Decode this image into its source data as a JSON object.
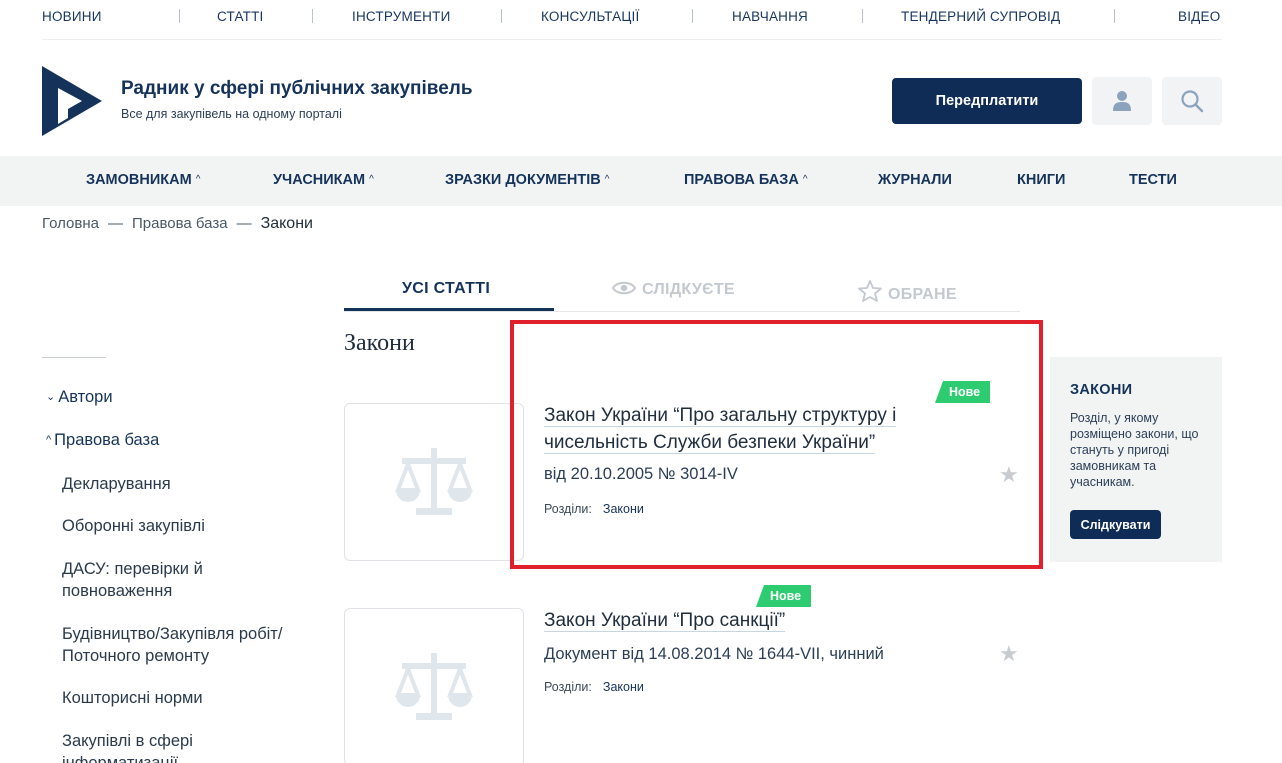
{
  "topnav": [
    "НОВИНИ",
    "СТАТТІ",
    "ІНСТРУМЕНТИ",
    "КОНСУЛЬТАЦІЇ",
    "НАВЧАННЯ",
    "ТЕНДЕРНИЙ СУПРОВІД",
    "ВІДЕО"
  ],
  "header": {
    "title": "Радник у сфері публічних закупівель",
    "subtitle": "Все для закупівель на одному порталі",
    "subscribe_label": "Передплатити",
    "icons": [
      "user-icon",
      "search-icon"
    ]
  },
  "mainnav": [
    {
      "label": "ЗАМОВНИКАМ",
      "dropdown": true
    },
    {
      "label": "УЧАСНИКАМ",
      "dropdown": true
    },
    {
      "label": "ЗРАЗКИ ДОКУМЕНТІВ",
      "dropdown": true
    },
    {
      "label": "ПРАВОВА БАЗА",
      "dropdown": true
    },
    {
      "label": "ЖУРНАЛИ",
      "dropdown": false
    },
    {
      "label": "КНИГИ",
      "dropdown": false
    },
    {
      "label": "ТЕСТИ",
      "dropdown": false
    }
  ],
  "breadcrumb": {
    "items": [
      "Головна",
      "Правова база"
    ],
    "separator": "—",
    "current": "Закони"
  },
  "tabs": [
    "УСІ СТАТТІ",
    "СЛІДКУЄТЕ",
    "ОБРАНЕ"
  ],
  "section_title": "Закони",
  "sidebar": {
    "top": [
      {
        "label": "Автори",
        "caret": "⌄"
      },
      {
        "label": "Правова база",
        "caret": "^"
      }
    ],
    "items": [
      "Декларування",
      "Оборонні закупівлі",
      "ДАСУ: перевірки й повноваження",
      "Будівництво/Закупівля робіт/ Поточного ремонту",
      "Кошторисні норми",
      "Закупівлі в сфері інформатизації"
    ]
  },
  "articles": [
    {
      "badge": "Нове",
      "title": "Закон України “Про загальну структуру і чисельність Служби безпеки України”",
      "meta": "від 20.10.2005 № 3014-IV",
      "sections_label": "Розділи:",
      "section": "Закони"
    },
    {
      "badge": "Нове",
      "title": "Закон України “Про санкції”",
      "meta": "Документ від 14.08.2014 № 1644-VII, чинний",
      "sections_label": "Розділи:",
      "section": "Закони"
    }
  ],
  "infobox": {
    "title": "ЗАКОНИ",
    "text": "Розділ, у якому розміщено закони, що стануть у пригоді замовникам та учасникам.",
    "button": "Слідкувати"
  },
  "colors": {
    "brand": "#0f2c56",
    "badge": "#2ecc71",
    "highlight": "#e0212b",
    "nav_bg": "#f2f4f4"
  }
}
